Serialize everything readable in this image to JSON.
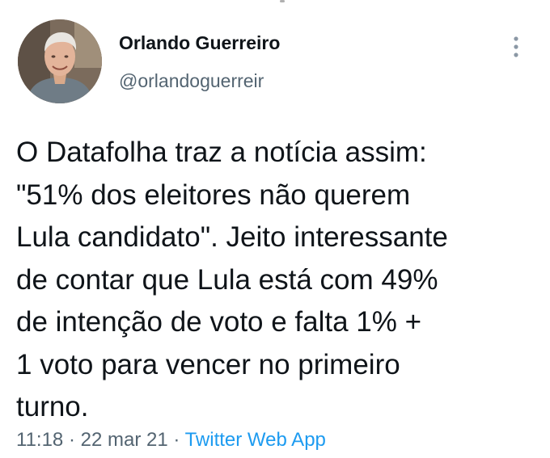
{
  "author": {
    "display_name": "Orlando Guerreiro",
    "handle": "@orlandoguerreir"
  },
  "tweet": {
    "lines": [
      "O Datafolha traz a notícia assim:",
      "\"51% dos eleitores não querem",
      "Lula candidato\". Jeito interessante",
      "de contar que Lula está com 49%",
      "de intenção de voto e falta 1% +",
      "1 voto para vencer no primeiro",
      "turno."
    ]
  },
  "meta": {
    "time": "11:18",
    "separator": " · ",
    "date": "22 mar 21",
    "source": "Twitter Web App"
  },
  "icons": {
    "avatar": "avatar-photo",
    "more": "more-vertical-icon"
  },
  "colors": {
    "text": "#0f1419",
    "secondary": "#536471",
    "link": "#1d9bf0"
  }
}
